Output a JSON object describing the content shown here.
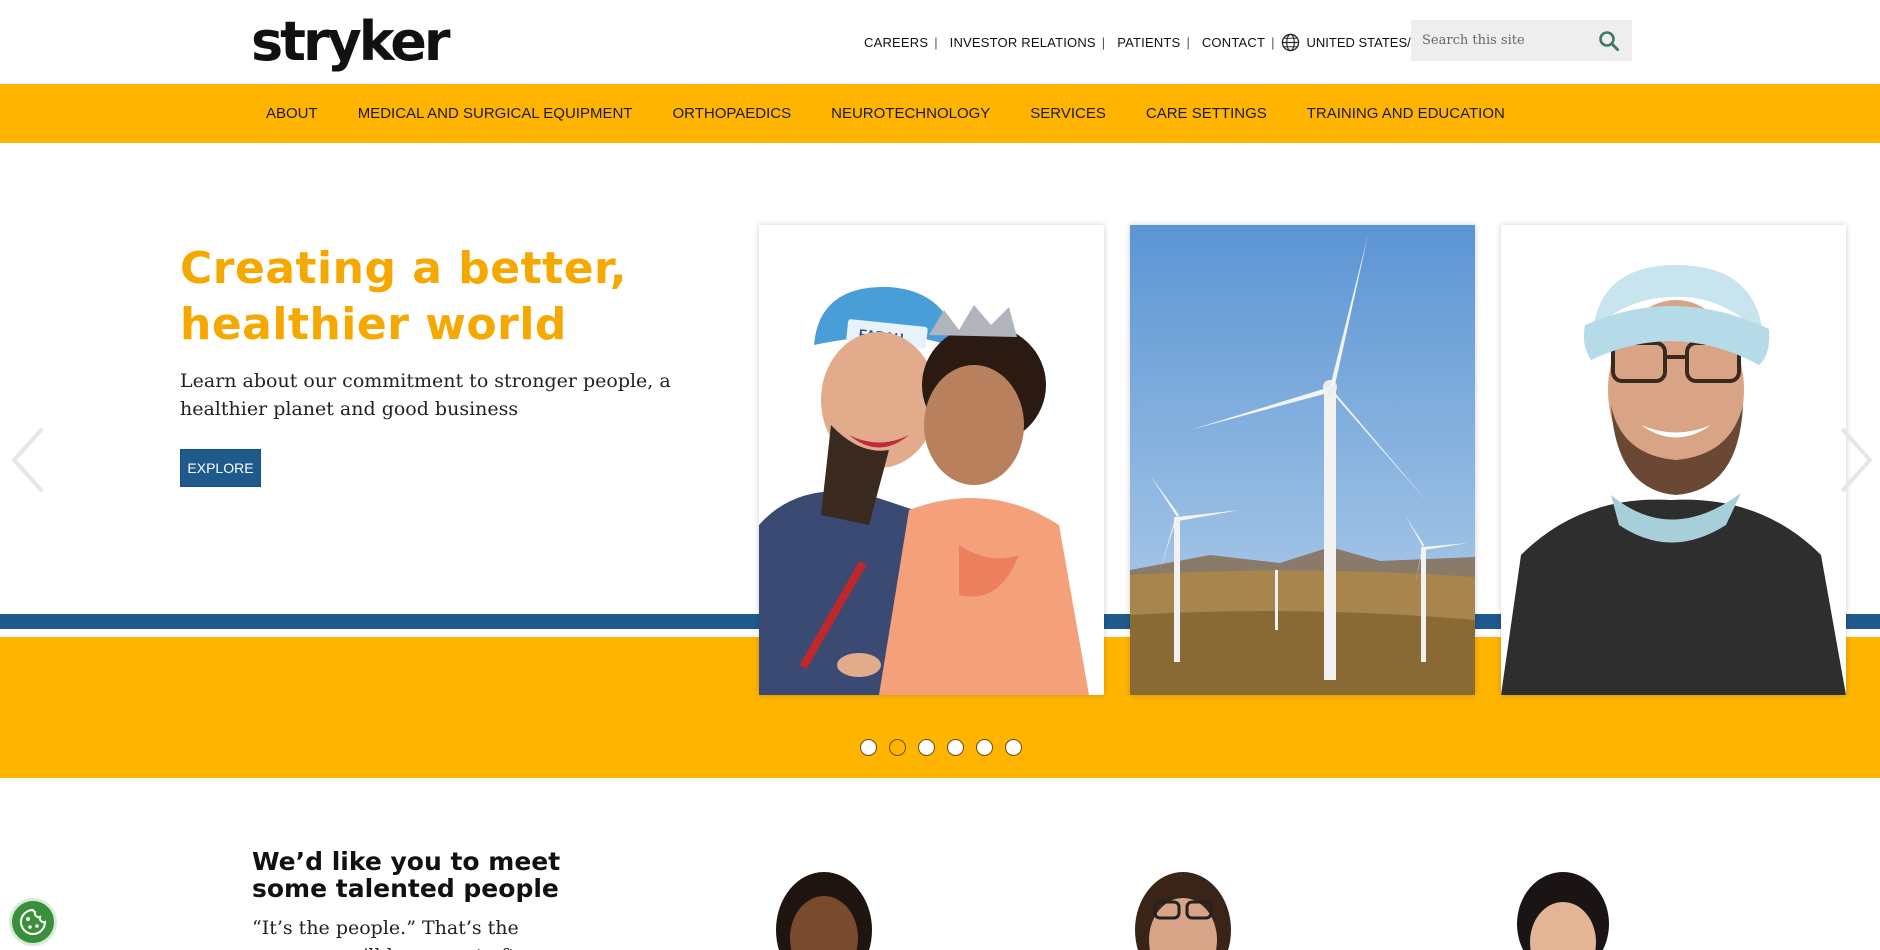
{
  "brand": {
    "logo_text": "stryker"
  },
  "utility_nav": {
    "links": [
      "CAREERS",
      "INVESTOR RELATIONS",
      "PATIENTS",
      "CONTACT"
    ],
    "separator": "|",
    "region": "UNITED STATES/ENGLISH"
  },
  "search": {
    "placeholder": "Search this site"
  },
  "main_nav": {
    "items": [
      "ABOUT",
      "MEDICAL AND SURGICAL EQUIPMENT",
      "ORTHOPAEDICS",
      "NEUROTECHNOLOGY",
      "SERVICES",
      "CARE SETTINGS",
      "TRAINING AND EDUCATION"
    ]
  },
  "hero": {
    "title_line1": "Creating a better,",
    "title_line2": "healthier world",
    "text": "Learn about our commitment to stronger people, a healthier planet and good business",
    "cta": "EXPLORE",
    "cap_name": "FARAH",
    "slide_count": 6,
    "active_slide": 2
  },
  "people": {
    "heading_line1": "We’d like you to meet",
    "heading_line2": "some talented people",
    "text": "“It’s the people.” That’s the answer you’ll hear most often"
  },
  "colors": {
    "brand_yellow": "#ffb500",
    "brand_blue": "#1f5a8c",
    "title_gold": "#f5a800"
  },
  "icons": [
    "globe-icon",
    "search-icon",
    "chevron-left-icon",
    "chevron-right-icon",
    "cookie-icon"
  ]
}
